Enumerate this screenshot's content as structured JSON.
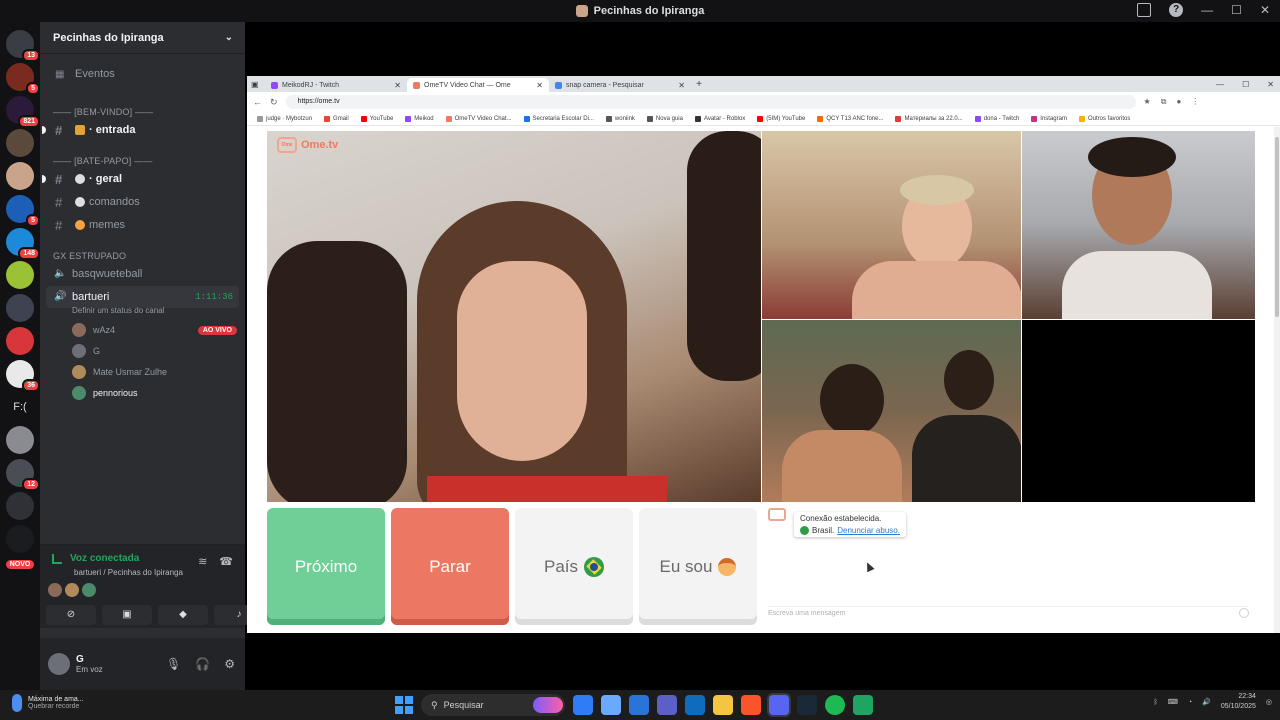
{
  "window": {
    "title": "Pecinhas do Ipiranga"
  },
  "rail": {
    "servers": [
      {
        "icon": "discord-home-icon",
        "color": "#3a3d44",
        "badge": "13"
      },
      {
        "icon": "server-icon",
        "color": "#7a2b1f",
        "badge": "5"
      },
      {
        "icon": "server-icon",
        "color": "#2b1a3a",
        "badge": "821"
      },
      {
        "icon": "server-icon",
        "color": "#5b4a3b",
        "badge": ""
      },
      {
        "icon": "server-icon",
        "color": "#c9a48a",
        "badge": ""
      },
      {
        "icon": "server-icon",
        "color": "#1d5fb6",
        "badge": "5"
      },
      {
        "icon": "server-icon",
        "color": "#1c8ad8",
        "badge": "148"
      },
      {
        "icon": "server-icon",
        "color": "#9bc234",
        "badge": ""
      },
      {
        "icon": "server-icon",
        "color": "#3f4250",
        "badge": ""
      },
      {
        "icon": "server-icon",
        "color": "#d7373a",
        "badge": ""
      },
      {
        "icon": "server-icon",
        "color": "#e9e9ea",
        "badge": "36"
      },
      {
        "icon": "server-text-icon",
        "color": "",
        "badge": "",
        "text": "F:("
      },
      {
        "icon": "server-icon",
        "color": "#8a8b90",
        "badge": ""
      },
      {
        "icon": "server-icon",
        "color": "#4b4d55",
        "badge": "12"
      },
      {
        "icon": "server-icon",
        "color": "#2f3136",
        "badge": ""
      },
      {
        "icon": "server-icon",
        "color": "#1b1c20",
        "badge": ""
      }
    ],
    "new_badge": "NOVO"
  },
  "sidebar": {
    "server_name": "Pecinhas do Ipiranga",
    "events": "Eventos",
    "cat_welcome": "—— [BEM-VINDO] ——",
    "ch_entrada": "· entrada",
    "cat_chat": "—— [BATE-PAPO] ——",
    "ch_geral": "· geral",
    "ch_comandos": "comandos",
    "ch_memes": "memes",
    "cat_voice": "GX ESTRUPADO",
    "vc_basq": "basqwueteball",
    "vc_bartueri": "bartueri",
    "vc_timer": "1:11:36",
    "vc_status": "Definir um status do canal",
    "users": [
      {
        "name": "wAz4",
        "color": "#8a6a5a",
        "live": "AO VIVO"
      },
      {
        "name": "G",
        "color": "#6d6f78",
        "live": ""
      },
      {
        "name": "Mate Usmar Zulhe",
        "color": "#b08a5a",
        "live": ""
      },
      {
        "name": "pennorious",
        "color": "#4b8a6a",
        "live": ""
      }
    ]
  },
  "voice_panel": {
    "title": "Voz conectada",
    "subtitle": "bartueri / Pecinhas do Ipiranga"
  },
  "user": {
    "name": "G",
    "status": "Em voz"
  },
  "browser": {
    "tabs": [
      {
        "label": "MeikodRJ - Twitch",
        "color": "#9146ff"
      },
      {
        "label": "OmeTV Video Chat — Ome",
        "color": "#f07a5f"
      },
      {
        "label": "snap camera - Pesquisar",
        "color": "#4285f4"
      }
    ],
    "url": "https://ome.tv",
    "bookmarks": [
      {
        "label": "judge · Mybotzun",
        "color": "#999"
      },
      {
        "label": "Gmail",
        "color": "#ea4335"
      },
      {
        "label": "YouTube",
        "color": "#ff0000"
      },
      {
        "label": "Meikod",
        "color": "#9146ff"
      },
      {
        "label": "OmeTV Video Chat...",
        "color": "#f07a5f"
      },
      {
        "label": "Secretaria Escolar Di...",
        "color": "#1a73e8"
      },
      {
        "label": "woniink",
        "color": "#555"
      },
      {
        "label": "Nova guia",
        "color": "#555"
      },
      {
        "label": "Avatar - Roblox",
        "color": "#333"
      },
      {
        "label": "(5IM) YouTube",
        "color": "#ff0000"
      },
      {
        "label": "QCY T13 ANC fone...",
        "color": "#ff6a00"
      },
      {
        "label": "Материалы за 22.0...",
        "color": "#e53935"
      },
      {
        "label": "dona - Twitch",
        "color": "#9146ff"
      },
      {
        "label": "Instagram",
        "color": "#c13584"
      },
      {
        "label": "Outros favoritos",
        "color": "#f4b400"
      }
    ]
  },
  "ometv": {
    "logo": "Ome.tv",
    "btn_next": "Próximo",
    "btn_stop": "Parar",
    "btn_country": "País",
    "btn_gender": "Eu sou",
    "chat_connected": "Conexão estabelecida.",
    "chat_country": "Brasil.",
    "chat_report": "Denunciar abuso.",
    "chat_placeholder": "Escreva uma mensagem"
  },
  "taskbar": {
    "weather_title": "Máxima de ama...",
    "weather_sub": "Quebrar recorde",
    "search": "Pesquisar",
    "time": "22:34",
    "date": "05/10/2025"
  }
}
